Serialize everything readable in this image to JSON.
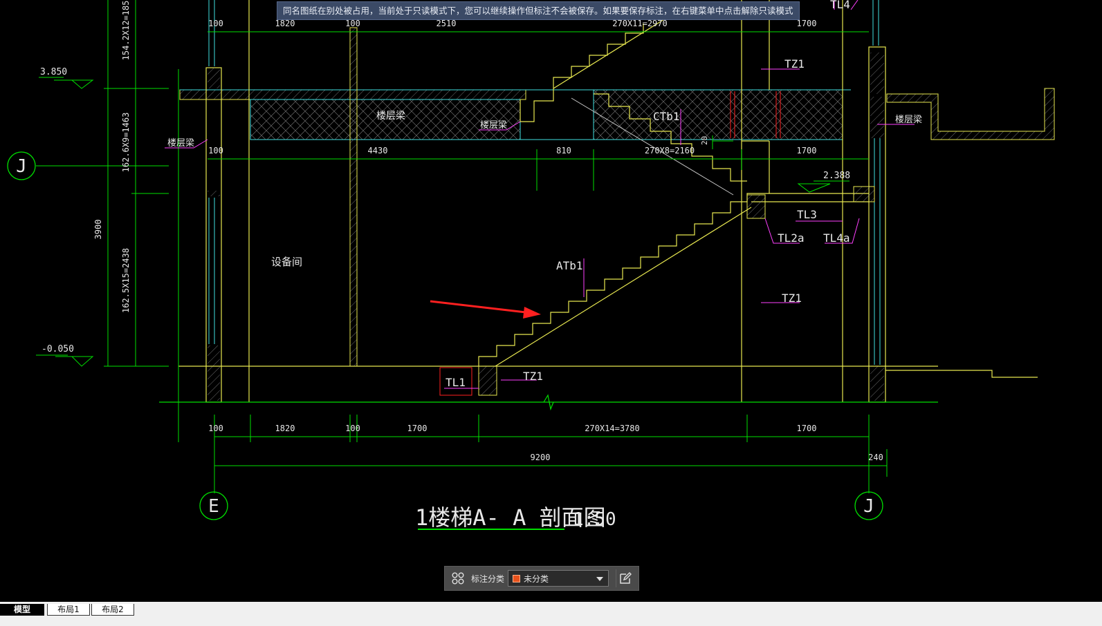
{
  "banner": {
    "message": "同名图纸在别处被占用，当前处于只读模式下，您可以继续操作但标注不会被保存。如果要保存标注，在右键菜单中点击解除只读模式"
  },
  "drawing": {
    "title": "1楼梯A- A 剖面图",
    "scale": "1:50",
    "levels": [
      "3.850",
      "-0.050",
      "2.388"
    ],
    "grid_axes": [
      "J",
      "E",
      "J"
    ],
    "vertical_dims": [
      "154.2X12=185",
      "162.6X9=1463",
      "162.5X15=2438",
      "3900"
    ],
    "top_dims": [
      "100",
      "1820",
      "100",
      "2510",
      "270X11=2970",
      "1700"
    ],
    "mid_dims": [
      "100",
      "4430",
      "810",
      "270X8=2160",
      "1700"
    ],
    "bottom_dims": [
      "100",
      "1820",
      "100",
      "1700",
      "270X14=3780",
      "1700"
    ],
    "overall_dims": [
      "9200",
      "240"
    ],
    "labels": {
      "floor_beam": "楼层梁",
      "equipment_room": "设备间",
      "ctb1": "CTb1",
      "atb1": "ATb1",
      "tz1": "TZ1",
      "tl1": "TL1",
      "tl3": "TL3",
      "tl2a": "TL2a",
      "tl4a": "TL4a",
      "tl4": "TL4",
      "small_dim": "20"
    }
  },
  "toolbar": {
    "label": "标注分类",
    "selected": "未分类",
    "swatch_color": "#e8521c"
  },
  "tabs": [
    "模型",
    "布局1",
    "布局2"
  ],
  "colors": {
    "green": "#00e000",
    "yellow": "#e8e850",
    "cyan": "#40e0e0",
    "magenta": "#ff40ff",
    "red": "#ff2020",
    "white": "#e8e8e8"
  }
}
